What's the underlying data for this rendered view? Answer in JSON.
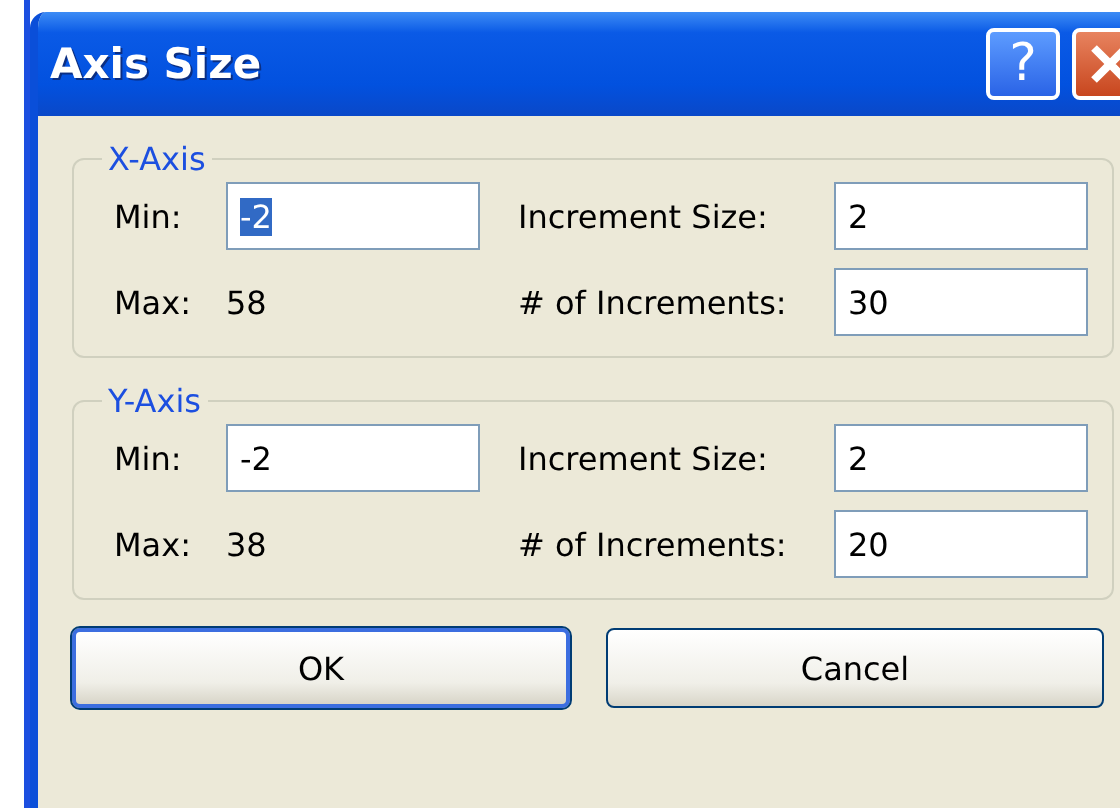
{
  "window": {
    "title": "Axis Size",
    "title_buttons": [
      "?"
    ]
  },
  "groups": [
    {
      "legend": "X-Axis",
      "min_label": "Min:",
      "min_value": "-2",
      "min_highlighted": true,
      "max_label": "Max:",
      "max_value": "58",
      "increment_size_label": "Increment Size:",
      "increment_size_value": "2",
      "increments_label": "# of Increments:",
      "increments_value": "30"
    },
    {
      "legend": "Y-Axis",
      "min_label": "Min:",
      "min_value": "-2",
      "min_highlighted": false,
      "max_label": "Max:",
      "max_value": "38",
      "increment_size_label": "Increment Size:",
      "increment_size_value": "2",
      "increments_label": "# of Increments:",
      "increments_value": "20"
    }
  ],
  "buttons": [
    {
      "label": "OK",
      "default": true
    },
    {
      "label": "Cancel",
      "default": false
    }
  ]
}
